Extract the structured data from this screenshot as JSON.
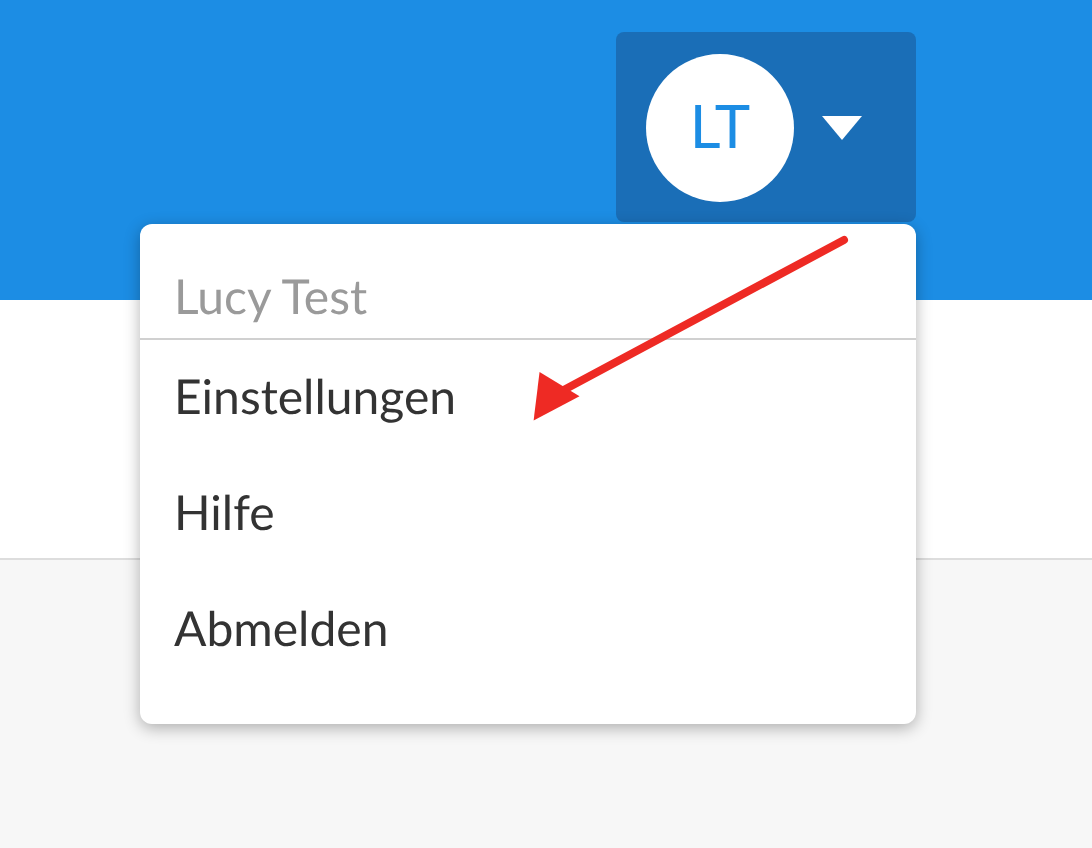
{
  "account_button": {
    "initials": "LT",
    "expanded": true
  },
  "menu": {
    "header": "Lucy Test",
    "items": [
      {
        "label": "Einstellungen"
      },
      {
        "label": "Hilfe"
      },
      {
        "label": "Abmelden"
      }
    ]
  }
}
